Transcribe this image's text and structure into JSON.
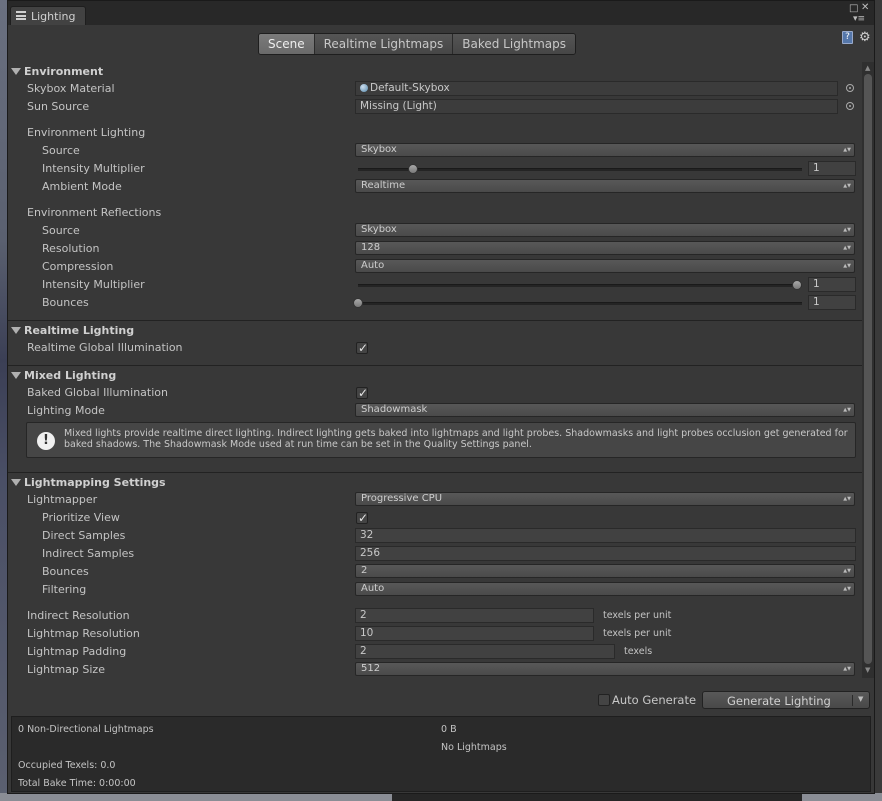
{
  "window": {
    "tab_title": "Lighting"
  },
  "modes": [
    "Scene",
    "Realtime Lightmaps",
    "Baked Lightmaps"
  ],
  "active_mode": "Scene",
  "environment": {
    "header": "Environment",
    "skybox_label": "Skybox Material",
    "skybox_value": "Default-Skybox",
    "sun_label": "Sun Source",
    "sun_value": "Missing (Light)",
    "env_lighting_label": "Environment Lighting",
    "source_label": "Source",
    "source_value": "Skybox",
    "intensity_label": "Intensity Multiplier",
    "intensity_value": "1",
    "ambient_label": "Ambient Mode",
    "ambient_value": "Realtime",
    "env_reflections_label": "Environment Reflections",
    "refl_source_label": "Source",
    "refl_source_value": "Skybox",
    "resolution_label": "Resolution",
    "resolution_value": "128",
    "compression_label": "Compression",
    "compression_value": "Auto",
    "refl_intensity_label": "Intensity Multiplier",
    "refl_intensity_value": "1",
    "bounces_label": "Bounces",
    "bounces_value": "1"
  },
  "realtime": {
    "header": "Realtime Lighting",
    "rgi_label": "Realtime Global Illumination"
  },
  "mixed": {
    "header": "Mixed Lighting",
    "bgi_label": "Baked Global Illumination",
    "mode_label": "Lighting Mode",
    "mode_value": "Shadowmask",
    "help_text": "Mixed lights provide realtime direct lighting. Indirect lighting gets baked into lightmaps and light probes. Shadowmasks and light probes occlusion get generated for baked shadows. The Shadowmask Mode used at run time can be set in the Quality Settings panel."
  },
  "lightmapping": {
    "header": "Lightmapping Settings",
    "lightmapper_label": "Lightmapper",
    "lightmapper_value": "Progressive CPU",
    "prioritize_label": "Prioritize View",
    "direct_label": "Direct Samples",
    "direct_value": "32",
    "indirect_label": "Indirect Samples",
    "indirect_value": "256",
    "bounces_label": "Bounces",
    "bounces_value": "2",
    "filtering_label": "Filtering",
    "filtering_value": "Auto",
    "indirect_res_label": "Indirect Resolution",
    "indirect_res_value": "2",
    "indirect_res_unit": "texels per unit",
    "lightmap_res_label": "Lightmap Resolution",
    "lightmap_res_value": "10",
    "lightmap_res_unit": "texels per unit",
    "padding_label": "Lightmap Padding",
    "padding_value": "2",
    "padding_unit": "texels",
    "size_label": "Lightmap Size",
    "size_value": "512"
  },
  "bottom": {
    "auto_generate_label": "Auto Generate",
    "generate_label": "Generate Lighting"
  },
  "stats": {
    "lightmaps_count": "0 Non-Directional Lightmaps",
    "lightmaps_size": "0 B",
    "no_lightmaps": "No Lightmaps",
    "occupied": "Occupied Texels: 0.0",
    "bake_time": "Total Bake Time: 0:00:00"
  }
}
